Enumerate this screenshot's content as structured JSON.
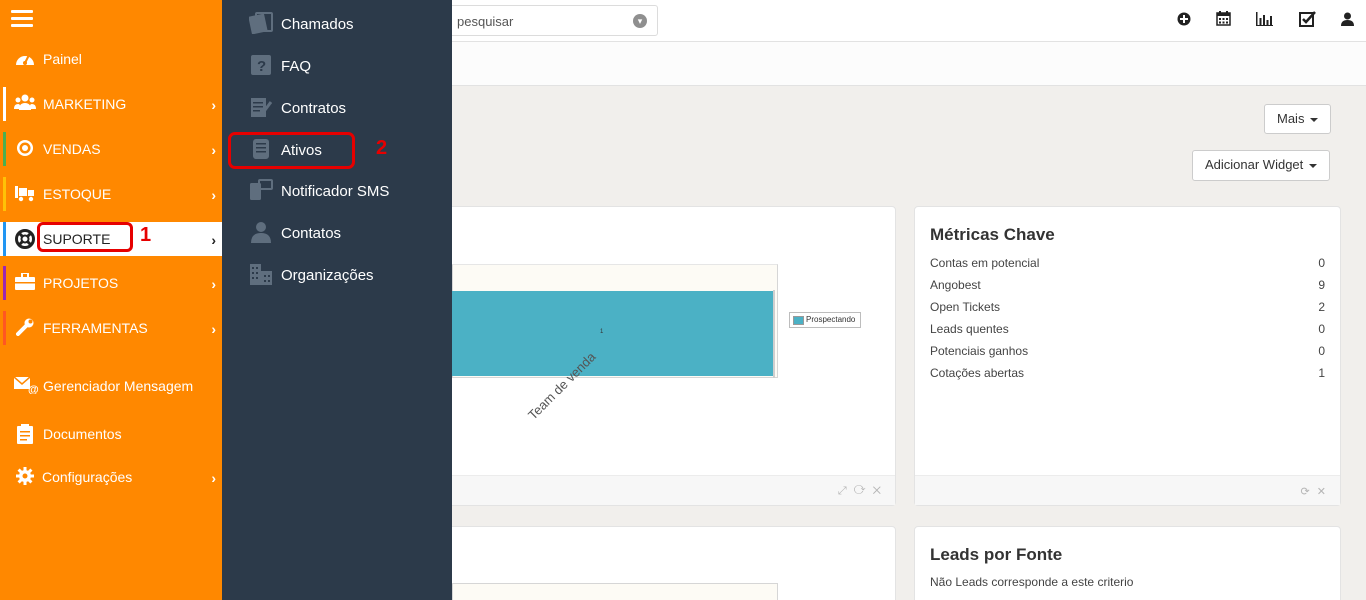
{
  "search": {
    "placeholder": "pesquisar"
  },
  "toolbar": {
    "icons": [
      "plus-circle-icon",
      "calendar-icon",
      "bar-chart-icon",
      "checkbox-icon",
      "user-icon"
    ]
  },
  "actions": {
    "mais": "Mais",
    "adicionar_widget": "Adicionar Widget"
  },
  "sidebar": {
    "items": [
      {
        "label": "Painel",
        "icon": "dashboard-icon"
      },
      {
        "label": "MARKETING",
        "icon": "users-icon",
        "color": "#ffffff"
      },
      {
        "label": "VENDAS",
        "icon": "target-icon",
        "color": "#4caf50"
      },
      {
        "label": "ESTOQUE",
        "icon": "truck-icon",
        "color": "#ffc107"
      },
      {
        "label": "SUPORTE",
        "icon": "lifebuoy-icon",
        "color": "#2196f3"
      },
      {
        "label": "PROJETOS",
        "icon": "briefcase-icon",
        "color": "#9c27b0"
      },
      {
        "label": "FERRAMENTAS",
        "icon": "wrench-icon",
        "color": "#ff5722"
      },
      {
        "label": "Gerenciador Mensagem",
        "icon": "mail-at-icon"
      },
      {
        "label": "Documentos",
        "icon": "document-icon"
      },
      {
        "label": "Configurações",
        "icon": "gear-icon"
      }
    ]
  },
  "annotations": {
    "step1": "1",
    "step2": "2"
  },
  "submenu": {
    "items": [
      {
        "label": "Chamados",
        "icon": "ticket-icon"
      },
      {
        "label": "FAQ",
        "icon": "faq-icon"
      },
      {
        "label": "Contratos",
        "icon": "contract-icon"
      },
      {
        "label": "Ativos",
        "icon": "asset-icon"
      },
      {
        "label": "Notificador SMS",
        "icon": "sms-icon"
      },
      {
        "label": "Contatos",
        "icon": "contact-icon"
      },
      {
        "label": "Organizações",
        "icon": "building-icon"
      }
    ]
  },
  "metricas": {
    "title": "Métricas Chave",
    "rows": [
      {
        "label": "Contas em potencial",
        "value": "0"
      },
      {
        "label": "Angobest",
        "value": "9"
      },
      {
        "label": "Open Tickets",
        "value": "2"
      },
      {
        "label": "Leads quentes",
        "value": "0"
      },
      {
        "label": "Potenciais ganhos",
        "value": "0"
      },
      {
        "label": "Cotações abertas",
        "value": "1"
      }
    ]
  },
  "leads": {
    "title": "Leads por Fonte",
    "empty_text": "Não Leads corresponde a este criterio"
  },
  "chart_data": {
    "type": "bar",
    "categories": [
      "Team de venda"
    ],
    "series": [
      {
        "name": "Prospectando",
        "values": [
          1
        ]
      }
    ],
    "data_labels": [
      "1"
    ],
    "legend": "right"
  }
}
